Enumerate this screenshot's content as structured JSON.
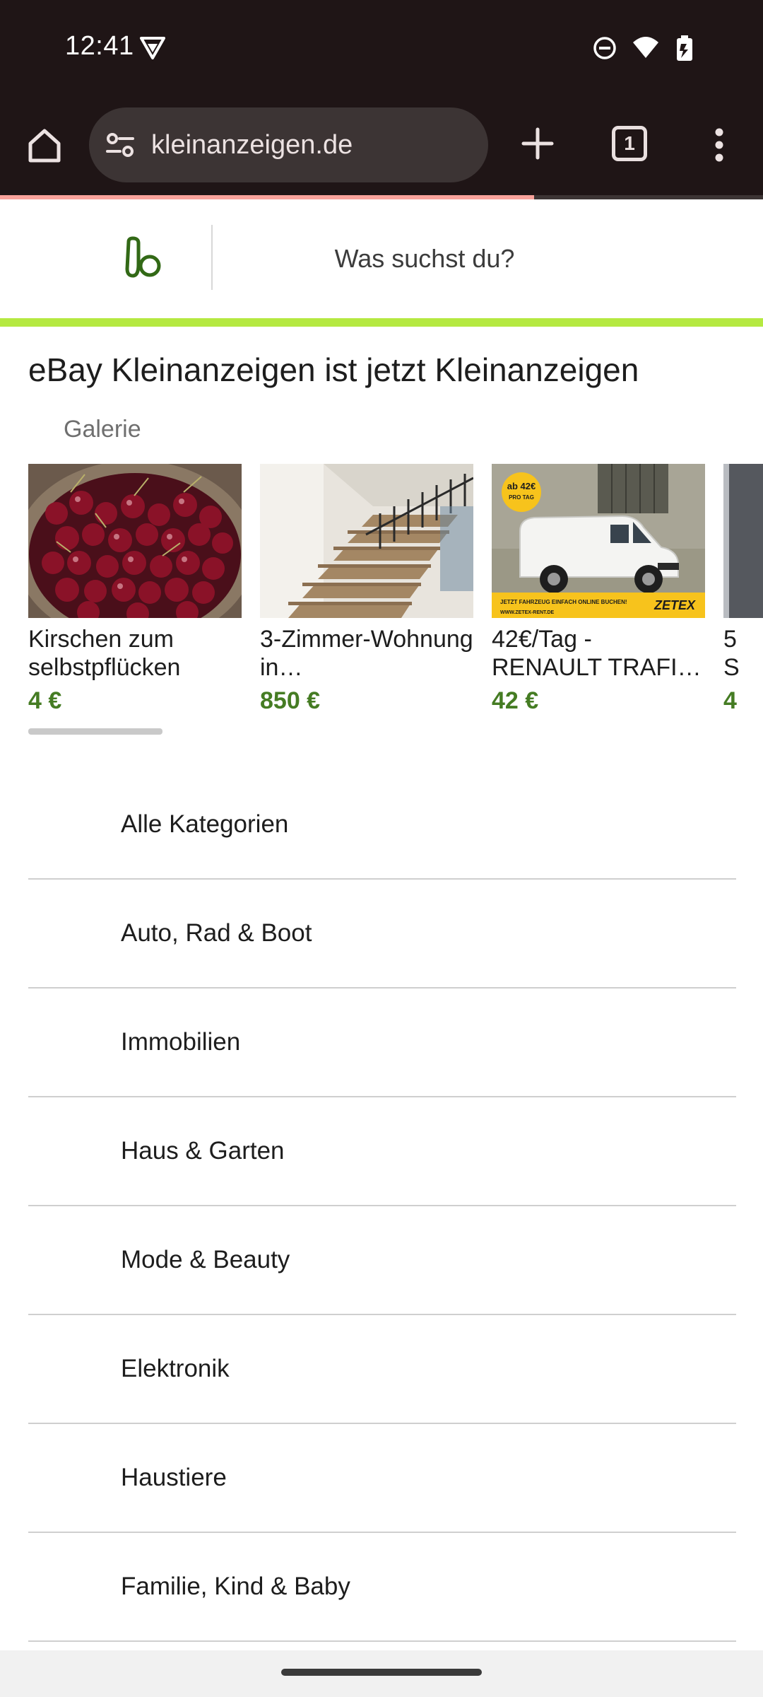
{
  "status": {
    "time": "12:41",
    "icons": [
      "vpn-icon",
      "dnd-icon",
      "wifi-icon",
      "battery-icon"
    ]
  },
  "browser": {
    "url": "kleinanzeigen.de",
    "tab_count": "1",
    "load_progress": 0.7
  },
  "header": {
    "search_placeholder": "Was suchst du?",
    "brand_color": "#b5e941"
  },
  "page": {
    "title": "eBay Kleinanzeigen ist jetzt Kleinanzeigen",
    "gallery_label": "Galerie"
  },
  "gallery": [
    {
      "title": "Kirschen zum selbstpflücken",
      "price": "4 €"
    },
    {
      "title": "3-Zimmer-Wohnung in…",
      "price": "850 €"
    },
    {
      "title": "42€/Tag - RENAULT TRAFI…",
      "price": "42 €",
      "badge_top": "ab 42€",
      "badge_bottom": "PRO TAG",
      "banner": "JETZT FAHRZEUG EINFACH ONLINE BUCHEN!",
      "brand": "ZETEX",
      "site": "WWW.ZETEX-RENT.DE"
    },
    {
      "title": "5 S",
      "price": "4"
    }
  ],
  "categories": [
    "Alle Kategorien",
    "Auto, Rad & Boot",
    "Immobilien",
    "Haus & Garten",
    "Mode & Beauty",
    "Elektronik",
    "Haustiere",
    "Familie, Kind & Baby"
  ]
}
